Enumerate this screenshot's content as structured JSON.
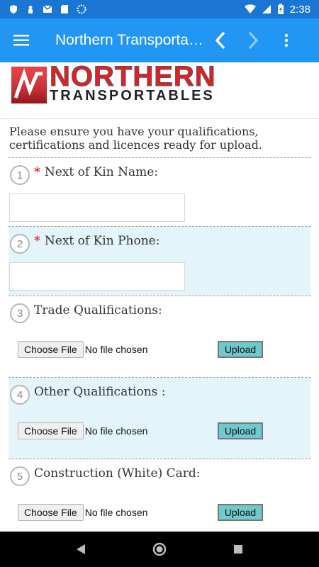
{
  "status_bar": {
    "time": "2:38",
    "icons": [
      "shield-icon",
      "person-pin-icon",
      "gmail-icon",
      "sd-card-icon",
      "sync-icon",
      "wifi-icon",
      "signal-icon",
      "battery-charging-icon"
    ],
    "bg_color": "#1a76d2"
  },
  "app_bar": {
    "title": "Northern Transportables",
    "icons": [
      "menu-icon",
      "back-chevron-icon",
      "forward-chevron-icon",
      "more-vert-icon"
    ],
    "bg_color": "#2196f3"
  },
  "logo": {
    "line1": "NORTHERN",
    "line2": "TRANSPORTABLES",
    "brand_color": "#e31e24"
  },
  "form": {
    "intro": "Please ensure you have your qualifications, certifications and licences ready for upload.",
    "questions": [
      {
        "number": "1",
        "required": true,
        "required_mark": "*",
        "label": "Next of Kin Name:",
        "type": "text",
        "value": ""
      },
      {
        "number": "2",
        "required": true,
        "required_mark": "*",
        "label": "Next of Kin Phone:",
        "type": "text",
        "value": ""
      },
      {
        "number": "3",
        "required": false,
        "label": "Trade Qualifications:",
        "type": "file",
        "choose_label": "Choose File",
        "file_status": "No file chosen",
        "upload_label": "Upload"
      },
      {
        "number": "4",
        "required": false,
        "label": "Other Qualifications :",
        "type": "file",
        "choose_label": "Choose File",
        "file_status": "No file chosen",
        "upload_label": "Upload"
      },
      {
        "number": "5",
        "required": false,
        "label": "Construction (White) Card:",
        "type": "file",
        "choose_label": "Choose File",
        "file_status": "No file chosen",
        "upload_label": "Upload"
      }
    ],
    "alt_row_color": "#e3f4fb",
    "upload_button_color": "#6fcacd"
  },
  "nav_bar": {
    "icons": [
      "back-triangle-icon",
      "home-circle-icon",
      "recents-square-icon"
    ]
  }
}
